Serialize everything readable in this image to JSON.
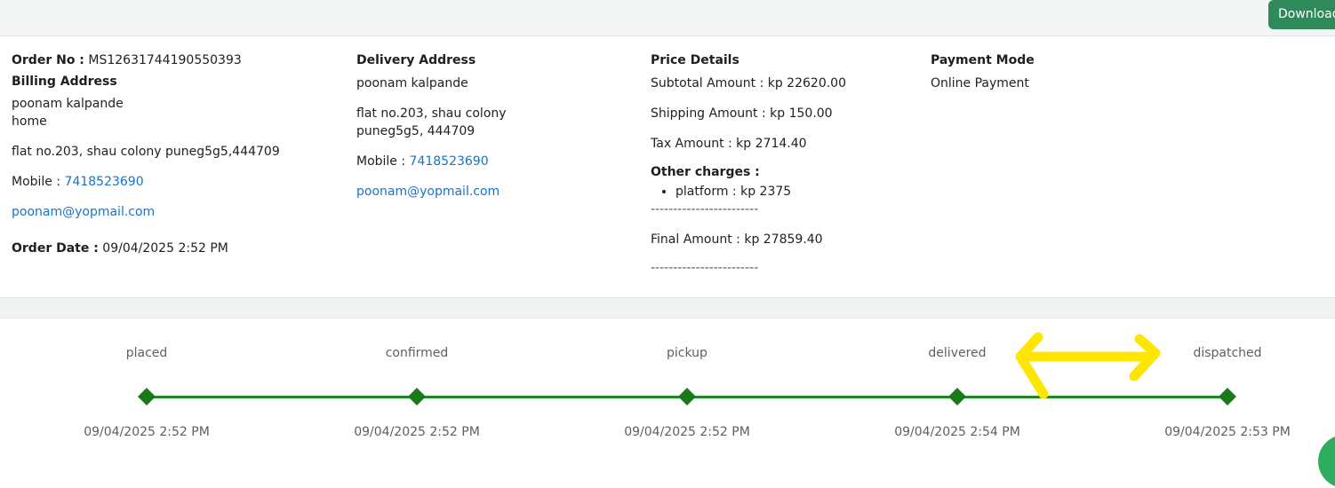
{
  "header": {
    "download_label": "Download"
  },
  "order": {
    "order_no_label": "Order No :",
    "order_no": "MS12631744190550393",
    "billing_title": "Billing Address",
    "billing_name": "poonam kalpande",
    "billing_type": "home",
    "billing_address": "flat no.203, shau colony puneg5g5,444709",
    "mobile_label": "Mobile :",
    "mobile": "7418523690",
    "email": "poonam@yopmail.com",
    "order_date_label": "Order Date :",
    "order_date": "09/04/2025 2:52 PM"
  },
  "delivery": {
    "title": "Delivery Address",
    "name": "poonam kalpande",
    "address_line1": "flat no.203, shau colony",
    "address_line2": "puneg5g5, 444709",
    "mobile_label": "Mobile :",
    "mobile": "7418523690",
    "email": "poonam@yopmail.com"
  },
  "price": {
    "title": "Price Details",
    "subtotal": "Subtotal Amount : kp 22620.00",
    "shipping": "Shipping Amount : kp 150.00",
    "tax": "Tax Amount : kp  2714.40",
    "other_title": "Other charges :",
    "other_items": [
      "platform :  kp  2375"
    ],
    "separator": "------------------------",
    "final": "Final Amount : kp  27859.40"
  },
  "payment": {
    "title": "Payment Mode",
    "mode": "Online Payment"
  },
  "tracker": {
    "color": "#1a8a1a",
    "steps": [
      {
        "label": "placed",
        "date": "09/04/2025 2:52 PM"
      },
      {
        "label": "confirmed",
        "date": "09/04/2025 2:52 PM"
      },
      {
        "label": "pickup",
        "date": "09/04/2025 2:52 PM"
      },
      {
        "label": "delivered",
        "date": "09/04/2025 2:54 PM"
      },
      {
        "label": "dispatched",
        "date": "09/04/2025 2:53 PM"
      }
    ]
  },
  "annotation": {
    "arrow_color": "#ffe600"
  }
}
